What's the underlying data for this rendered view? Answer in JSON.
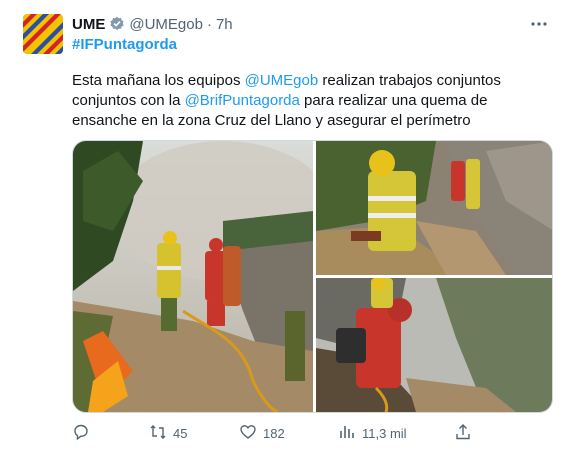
{
  "author": {
    "name": "UME",
    "handle": "@UMEgob",
    "separator": "·",
    "time": "7h"
  },
  "hashtag_line": "#IFPuntagorda",
  "text": {
    "part1": "Esta mañana los equipos ",
    "mention1": "@UMEgob",
    "part2": " realizan trabajos conjuntos conjuntos con la  ",
    "mention2": "@BrifPuntagorda",
    "part3": " para realizar una  quema de ensanche en la zona Cruz del Llano y asegurar el perímetro"
  },
  "actions": {
    "reply_count": "",
    "retweet_count": "45",
    "like_count": "182",
    "views_count": "11,3 mil"
  },
  "colors": {
    "accent": "#1d9bf0",
    "secondary_text": "#536471",
    "avatar_yellow": "#f3c300",
    "avatar_red": "#d1232a",
    "avatar_blue": "#2b4fa2"
  },
  "icons": {
    "verified": "verified-badge-icon",
    "more": "more-horizontal-icon",
    "reply": "reply-icon",
    "retweet": "retweet-icon",
    "like": "heart-icon",
    "views": "views-chart-icon",
    "share": "share-icon"
  }
}
